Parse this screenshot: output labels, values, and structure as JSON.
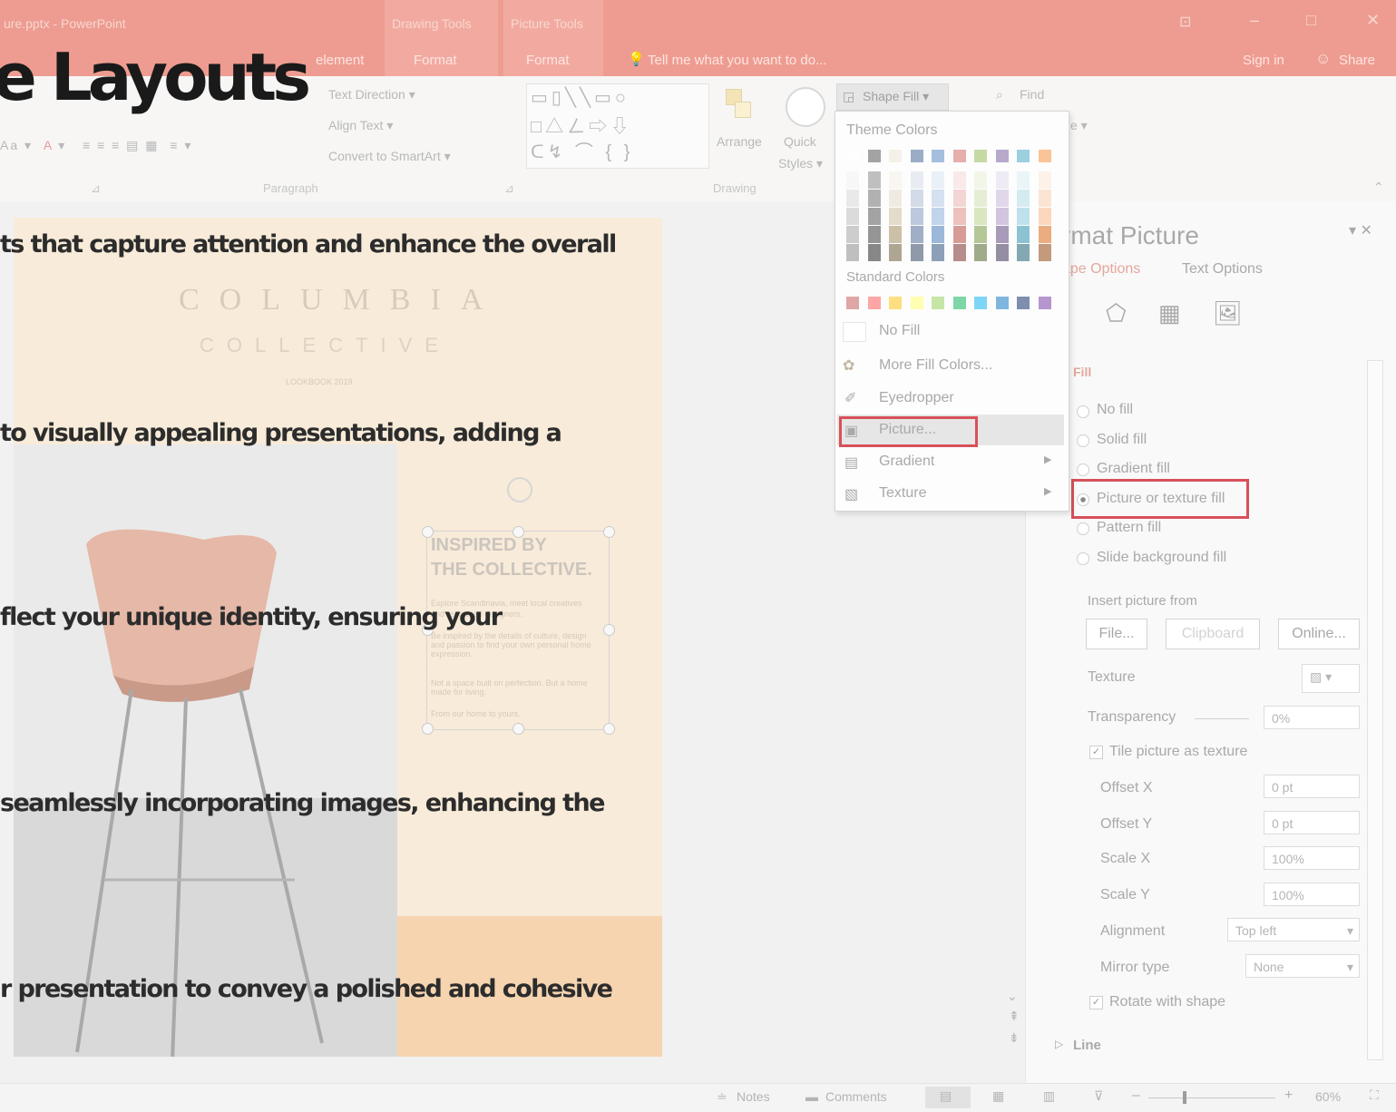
{
  "window": {
    "title": "ure.pptx - PowerPoint",
    "context_tabs": [
      "Drawing Tools",
      "Picture Tools"
    ],
    "controls": {
      "restore": "⊡",
      "minimize": "–",
      "maximize": "□",
      "close": "✕"
    }
  },
  "tabs": {
    "element": "element",
    "format1": "Format",
    "format2": "Format",
    "tell_me": "Tell me what you want to do...",
    "sign_in": "Sign in",
    "share": "Share"
  },
  "ribbon": {
    "text_direction": "Text Direction ▾",
    "align_text": "Align Text ▾",
    "convert_smartart": "Convert to SmartArt ▾",
    "paragraph_group": "Paragraph",
    "arrange": "Arrange",
    "quick_styles_1": "Quick",
    "quick_styles_2": "Styles ▾",
    "drawing_group": "Drawing",
    "shape_fill": "Shape Fill ▾",
    "find": "Find"
  },
  "overlay": {
    "title": "e Layouts",
    "line1": "ts that capture attention and enhance the overall",
    "line2": "to visually appealing presentations, adding a",
    "line3": "flect your unique identity, ensuring your",
    "line4": "seamlessly incorporating images, enhancing the",
    "line5": "r presentation to convey a polished and cohesive"
  },
  "slide": {
    "brand_line1": "COLUMBIA",
    "brand_line2": "COLLECTIVE",
    "lookbook": "LOOKBOOK 2019",
    "heading_1": "INSPIRED BY",
    "heading_2": "THE COLLECTIVE.",
    "body_1": "Explore Scandinavia, meet local creatives",
    "body_2": "and renowned designers.",
    "body_3": "Be inspired by the details of culture, design and passion to find your own personal home expression.",
    "body_4": "Not a space built on perfection. But a home made for living.",
    "body_5": "From our home to yours."
  },
  "dropdown": {
    "theme_colors": "Theme Colors",
    "standard_colors": "Standard Colors",
    "no_fill": "No Fill",
    "more_fill_colors": "More Fill Colors...",
    "eyedropper": "Eyedropper",
    "picture": "Picture...",
    "gradient": "Gradient",
    "texture": "Texture",
    "theme_top_row": [
      "#ffffff",
      "#595959",
      "#efe8d8",
      "#4a6b99",
      "#5b8cc4",
      "#d2706a",
      "#9bbb59",
      "#8064a2",
      "#4bacc6",
      "#f79646"
    ],
    "theme_columns": [
      [
        "#f2f2f2",
        "#d9d9d9",
        "#bfbfbf",
        "#a6a6a6",
        "#8c8c8c"
      ],
      [
        "#8c8c8c",
        "#737373",
        "#595959",
        "#404040",
        "#262626"
      ],
      [
        "#f5f1e9",
        "#e5dcc8",
        "#cfc0a0",
        "#a58e63",
        "#6e5d3d"
      ],
      [
        "#d7dfea",
        "#afc0d6",
        "#879fc1",
        "#536f99",
        "#344764"
      ],
      [
        "#dae5f2",
        "#b5cbe6",
        "#8fb2da",
        "#4b7fbb",
        "#2f5480"
      ],
      [
        "#f5d9d7",
        "#ebb4b0",
        "#e08f88",
        "#b94c43",
        "#7c322c"
      ],
      [
        "#e8f0d9",
        "#d2e2b3",
        "#bbd38d",
        "#7c9a43",
        "#536729"
      ],
      [
        "#e4dcec",
        "#c9b9da",
        "#ae97c7",
        "#614a82",
        "#403157"
      ],
      [
        "#d8eef3",
        "#b1dde8",
        "#8bcbdc",
        "#2f94ae",
        "#1f6374"
      ],
      [
        "#fde7d7",
        "#fbcfb0",
        "#f9b888",
        "#dd6c1a",
        "#944811"
      ]
    ],
    "standard_row": [
      "#c0504d",
      "#ff5050",
      "#ffc000",
      "#ffff66",
      "#92d050",
      "#00b050",
      "#00b0f0",
      "#0070c0",
      "#002060",
      "#7030a0"
    ]
  },
  "pane": {
    "title": "rmat Picture",
    "tab_shape": "ape Options",
    "tab_text": "Text Options",
    "fill_section": "Fill",
    "no_fill": "No fill",
    "solid_fill": "Solid fill",
    "gradient_fill": "Gradient fill",
    "picture_texture_fill": "Picture or texture fill",
    "pattern_fill": "Pattern fill",
    "slide_bg_fill": "Slide background fill",
    "insert_from": "Insert picture from",
    "file_btn": "File...",
    "clipboard_btn": "Clipboard",
    "online_btn": "Online...",
    "texture": "Texture",
    "transparency": "Transparency",
    "transparency_value": "0%",
    "tile_label": "Tile picture as texture",
    "offset_x": "Offset X",
    "offset_x_value": "0 pt",
    "offset_y": "Offset Y",
    "offset_y_value": "0 pt",
    "scale_x": "Scale X",
    "scale_x_value": "100%",
    "scale_y": "Scale Y",
    "scale_y_value": "100%",
    "alignment": "Alignment",
    "alignment_value": "Top left",
    "mirror": "Mirror type",
    "mirror_value": "None",
    "rotate_label": "Rotate with shape",
    "line_section": "Line"
  },
  "status": {
    "notes": "Notes",
    "comments": "Comments",
    "zoom": "60%"
  }
}
